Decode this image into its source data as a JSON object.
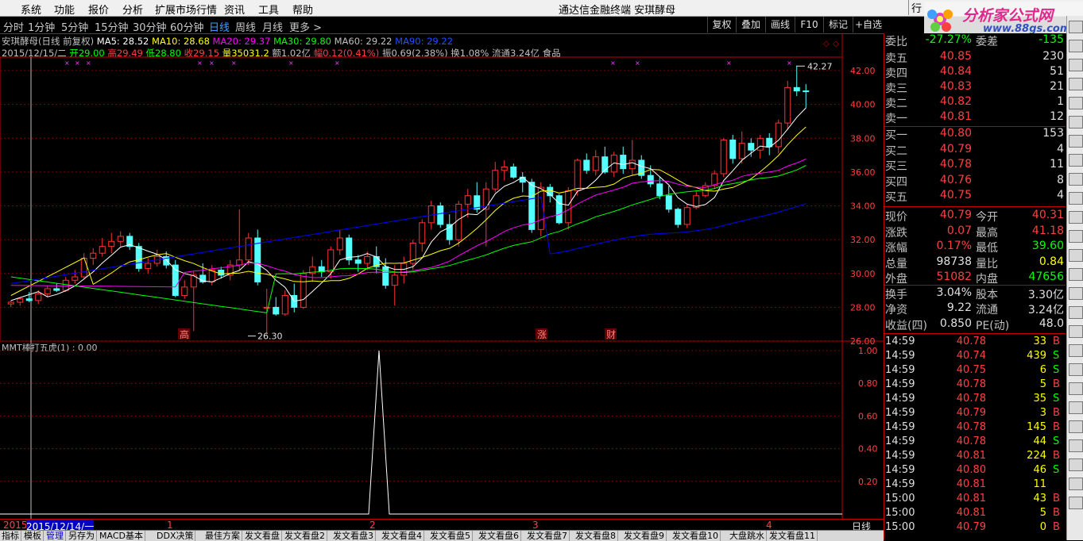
{
  "menu": {
    "items": [
      "系统",
      "功能",
      "报价",
      "分析",
      "扩展市场行情",
      "资讯",
      "工具",
      "帮助"
    ],
    "window_title": "通达信金融终端   安琪酵母",
    "right_cut": "行"
  },
  "logo": {
    "text": "分析家公式网",
    "url": "www.88gs.com"
  },
  "periods": {
    "items": [
      "分时",
      "1分钟",
      "5分钟",
      "15分钟",
      "30分钟",
      "60分钟",
      "日线",
      "周线",
      "月线",
      "更多 >"
    ],
    "active": "日线"
  },
  "toolbar_right": [
    "复权",
    "叠加",
    "画线",
    "F10",
    "标记",
    "+自选"
  ],
  "header": {
    "line1": {
      "name": "安琪酵母(日线 前复权)",
      "ma5": "MA5: 28.52",
      "ma10": "MA10: 28.68",
      "ma20": "MA20: 29.37",
      "ma30": "MA30: 29.80",
      "ma60": "MA60: 29.22",
      "ma90": "MA90: 29.22"
    },
    "line2": {
      "date": "2015/12/15/二",
      "open": "开29.00",
      "high": "高29.49",
      "low": "低28.80",
      "close": "收29.15",
      "vol": "量35031.2",
      "amt": "额1.02亿",
      "chg": "幅0.12(0.41%)",
      "amp": "振0.69(2.38%)",
      "turn": "换1.08%",
      "circ": "流通3.24亿",
      "sector": "食品"
    }
  },
  "chart_data": {
    "type": "candlestick",
    "ylim": [
      26,
      42.8
    ],
    "yticks": [
      "42.00",
      "40.00",
      "38.00",
      "36.00",
      "34.00",
      "32.00",
      "30.00",
      "28.00",
      "26.00"
    ],
    "high_label": "42.27",
    "low_label": "26.30",
    "event_labels": [
      "高",
      "涨",
      "财"
    ],
    "candles": [
      [
        28.2,
        28.4,
        28.0,
        28.3
      ],
      [
        28.3,
        28.6,
        28.1,
        28.5
      ],
      [
        28.5,
        28.9,
        28.3,
        28.4
      ],
      [
        28.4,
        29.0,
        28.2,
        28.8
      ],
      [
        28.8,
        29.3,
        28.6,
        29.1
      ],
      [
        29.1,
        29.4,
        28.9,
        29.0
      ],
      [
        29.0,
        29.8,
        28.9,
        29.6
      ],
      [
        29.6,
        30.2,
        29.4,
        29.8
      ],
      [
        29.8,
        31.2,
        29.7,
        30.9
      ],
      [
        30.9,
        31.5,
        30.5,
        31.2
      ],
      [
        31.2,
        32.1,
        31.0,
        31.6
      ],
      [
        31.6,
        32.4,
        31.2,
        31.9
      ],
      [
        31.9,
        32.5,
        31.6,
        32.2
      ],
      [
        32.2,
        32.4,
        31.4,
        31.6
      ],
      [
        31.6,
        31.8,
        30.1,
        30.3
      ],
      [
        30.3,
        30.9,
        30.0,
        30.6
      ],
      [
        30.6,
        31.4,
        30.4,
        31.0
      ],
      [
        31.0,
        31.3,
        30.3,
        30.5
      ],
      [
        30.5,
        30.8,
        28.6,
        28.7
      ],
      [
        28.7,
        29.6,
        28.5,
        29.2
      ],
      [
        29.2,
        30.1,
        26.6,
        29.9
      ],
      [
        29.9,
        30.6,
        29.4,
        29.5
      ],
      [
        29.5,
        30.5,
        29.3,
        30.2
      ],
      [
        30.2,
        30.4,
        29.7,
        29.9
      ],
      [
        29.9,
        30.8,
        29.6,
        30.5
      ],
      [
        30.5,
        33.8,
        30.2,
        30.8
      ],
      [
        30.8,
        32.4,
        30.5,
        32.1
      ],
      [
        32.1,
        32.6,
        29.3,
        29.5
      ],
      [
        28.0,
        29.1,
        26.4,
        28.0
      ],
      [
        28.0,
        28.6,
        27.5,
        27.6
      ],
      [
        27.6,
        29.0,
        27.5,
        28.7
      ],
      [
        28.7,
        29.4,
        27.7,
        28.0
      ],
      [
        28.0,
        30.2,
        27.9,
        30.0
      ],
      [
        30.0,
        31.0,
        29.5,
        30.4
      ],
      [
        30.4,
        30.8,
        29.8,
        30.1
      ],
      [
        30.1,
        31.6,
        29.7,
        31.4
      ],
      [
        31.4,
        32.6,
        31.1,
        32.1
      ],
      [
        32.1,
        32.3,
        30.5,
        30.8
      ],
      [
        30.8,
        31.1,
        30.1,
        30.6
      ],
      [
        30.6,
        31.3,
        30.2,
        31.0
      ],
      [
        31.0,
        31.6,
        30.0,
        30.4
      ],
      [
        30.4,
        30.9,
        29.1,
        29.3
      ],
      [
        29.3,
        30.5,
        28.1,
        29.9
      ],
      [
        29.9,
        31.0,
        29.4,
        30.6
      ],
      [
        30.6,
        32.0,
        30.2,
        31.8
      ],
      [
        31.8,
        33.2,
        31.3,
        33.0
      ],
      [
        33.0,
        34.3,
        32.6,
        34.0
      ],
      [
        34.0,
        34.2,
        32.7,
        32.9
      ],
      [
        32.9,
        33.5,
        31.7,
        32.0
      ],
      [
        32.0,
        34.3,
        31.6,
        34.1
      ],
      [
        34.1,
        35.0,
        33.3,
        34.6
      ],
      [
        34.6,
        35.4,
        33.6,
        33.8
      ],
      [
        33.8,
        35.4,
        31.6,
        35.0
      ],
      [
        35.0,
        36.6,
        34.8,
        36.1
      ],
      [
        36.1,
        36.7,
        35.5,
        36.3
      ],
      [
        36.3,
        36.5,
        35.6,
        35.7
      ],
      [
        35.7,
        36.0,
        34.8,
        35.4
      ],
      [
        35.4,
        35.6,
        32.4,
        32.6
      ],
      [
        32.6,
        35.4,
        32.2,
        35.1
      ],
      [
        35.1,
        35.3,
        34.2,
        34.6
      ],
      [
        34.6,
        34.7,
        32.9,
        33.0
      ],
      [
        33.0,
        35.1,
        32.6,
        34.9
      ],
      [
        34.9,
        36.8,
        34.6,
        36.7
      ],
      [
        36.7,
        37.1,
        35.9,
        36.1
      ],
      [
        36.1,
        37.3,
        35.8,
        36.9
      ],
      [
        36.9,
        37.5,
        35.9,
        36.0
      ],
      [
        36.0,
        37.2,
        35.7,
        37.0
      ],
      [
        37.0,
        37.5,
        35.9,
        36.2
      ],
      [
        36.2,
        37.9,
        35.8,
        36.7
      ],
      [
        36.7,
        37.0,
        35.6,
        35.8
      ],
      [
        35.8,
        36.4,
        35.1,
        35.3
      ],
      [
        35.3,
        35.7,
        34.4,
        34.6
      ],
      [
        34.6,
        35.2,
        33.6,
        33.8
      ],
      [
        33.8,
        33.9,
        32.7,
        32.9
      ],
      [
        32.9,
        34.1,
        32.7,
        33.9
      ],
      [
        33.9,
        34.9,
        33.8,
        34.6
      ],
      [
        34.6,
        35.4,
        34.5,
        35.2
      ],
      [
        35.2,
        36.1,
        35.0,
        35.9
      ],
      [
        35.9,
        38.0,
        35.7,
        37.9
      ],
      [
        37.9,
        38.2,
        36.5,
        36.8
      ],
      [
        36.8,
        38.4,
        36.5,
        37.7
      ],
      [
        37.7,
        38.0,
        36.9,
        37.3
      ],
      [
        37.3,
        38.2,
        36.8,
        38.0
      ],
      [
        38.0,
        38.3,
        37.0,
        37.5
      ],
      [
        37.5,
        39.1,
        37.1,
        38.9
      ],
      [
        38.9,
        41.4,
        38.5,
        41.0
      ],
      [
        41.0,
        42.27,
        40.5,
        40.8
      ],
      [
        40.8,
        41.2,
        39.8,
        40.79
      ]
    ]
  },
  "indicator": {
    "title": "MMT棒打五虎(1) : 0.00",
    "yticks": [
      "1.00",
      "0.80",
      "0.60",
      "0.40",
      "0.20"
    ]
  },
  "timeaxis": {
    "labels": [
      "2015",
      "2015/12/14/一",
      "1",
      "2",
      "3",
      "4"
    ],
    "period": "日线"
  },
  "bottom_tabs": [
    "指标",
    "模板",
    "管理",
    "另存为",
    "MACD基本",
    "DDX决策",
    "最佳方案",
    "发文看盘",
    "发文看盘2",
    "发文看盘3",
    "发文看盘4",
    "发文看盘5",
    "发文看盘6",
    "发文看盘7",
    "发文看盘8",
    "发文看盘9",
    "发文看盘10",
    "大盘跳水",
    "发文看盘11"
  ],
  "quote": {
    "webi": {
      "label": "委比",
      "value": "-27.27%",
      "label2": "委差",
      "value2": "-135"
    },
    "asks": [
      {
        "label": "卖五",
        "price": "40.85",
        "vol": "230"
      },
      {
        "label": "卖四",
        "price": "40.84",
        "vol": "51"
      },
      {
        "label": "卖三",
        "price": "40.83",
        "vol": "21"
      },
      {
        "label": "卖二",
        "price": "40.82",
        "vol": "1"
      },
      {
        "label": "卖一",
        "price": "40.81",
        "vol": "12"
      }
    ],
    "bids": [
      {
        "label": "买一",
        "price": "40.80",
        "vol": "153"
      },
      {
        "label": "买二",
        "price": "40.79",
        "vol": "4"
      },
      {
        "label": "买三",
        "price": "40.78",
        "vol": "11"
      },
      {
        "label": "买四",
        "price": "40.76",
        "vol": "8"
      },
      {
        "label": "买五",
        "price": "40.75",
        "vol": "4"
      }
    ],
    "stats": [
      [
        "现价",
        "40.79",
        "今开",
        "40.31"
      ],
      [
        "涨跌",
        "0.07",
        "最高",
        "41.18"
      ],
      [
        "涨幅",
        "0.17%",
        "最低",
        "39.60"
      ],
      [
        "总量",
        "98738",
        "量比",
        "0.84"
      ],
      [
        "外盘",
        "51082",
        "内盘",
        "47656"
      ],
      [
        "换手",
        "3.04%",
        "股本",
        "3.30亿"
      ],
      [
        "净资",
        "9.22",
        "流通",
        "3.24亿"
      ],
      [
        "收益(四)",
        "0.850",
        "PE(动)",
        "48.0"
      ]
    ],
    "ticks": [
      [
        "14:59",
        "40.78",
        "33",
        "B"
      ],
      [
        "14:59",
        "40.74",
        "439",
        "S"
      ],
      [
        "14:59",
        "40.75",
        "6",
        "S"
      ],
      [
        "14:59",
        "40.78",
        "5",
        "B"
      ],
      [
        "14:59",
        "40.78",
        "35",
        "S"
      ],
      [
        "14:59",
        "40.79",
        "3",
        "B"
      ],
      [
        "14:59",
        "40.78",
        "145",
        "B"
      ],
      [
        "14:59",
        "40.78",
        "44",
        "S"
      ],
      [
        "14:59",
        "40.81",
        "224",
        "B"
      ],
      [
        "14:59",
        "40.80",
        "46",
        "S"
      ],
      [
        "14:59",
        "40.81",
        "11",
        ""
      ],
      [
        "15:00",
        "40.81",
        "43",
        "B"
      ],
      [
        "15:00",
        "40.81",
        "5",
        "B"
      ],
      [
        "15:00",
        "40.79",
        "0",
        "B"
      ]
    ]
  },
  "colors": {
    "up": "#ff3232",
    "down": "#54ffff",
    "ma5": "#ffffff",
    "ma10": "#ffff00",
    "ma20": "#ff00ff",
    "ma30": "#00ff00",
    "ma60": "#0000ff",
    "price": "#ff4040",
    "label": "#c0c0c0"
  }
}
